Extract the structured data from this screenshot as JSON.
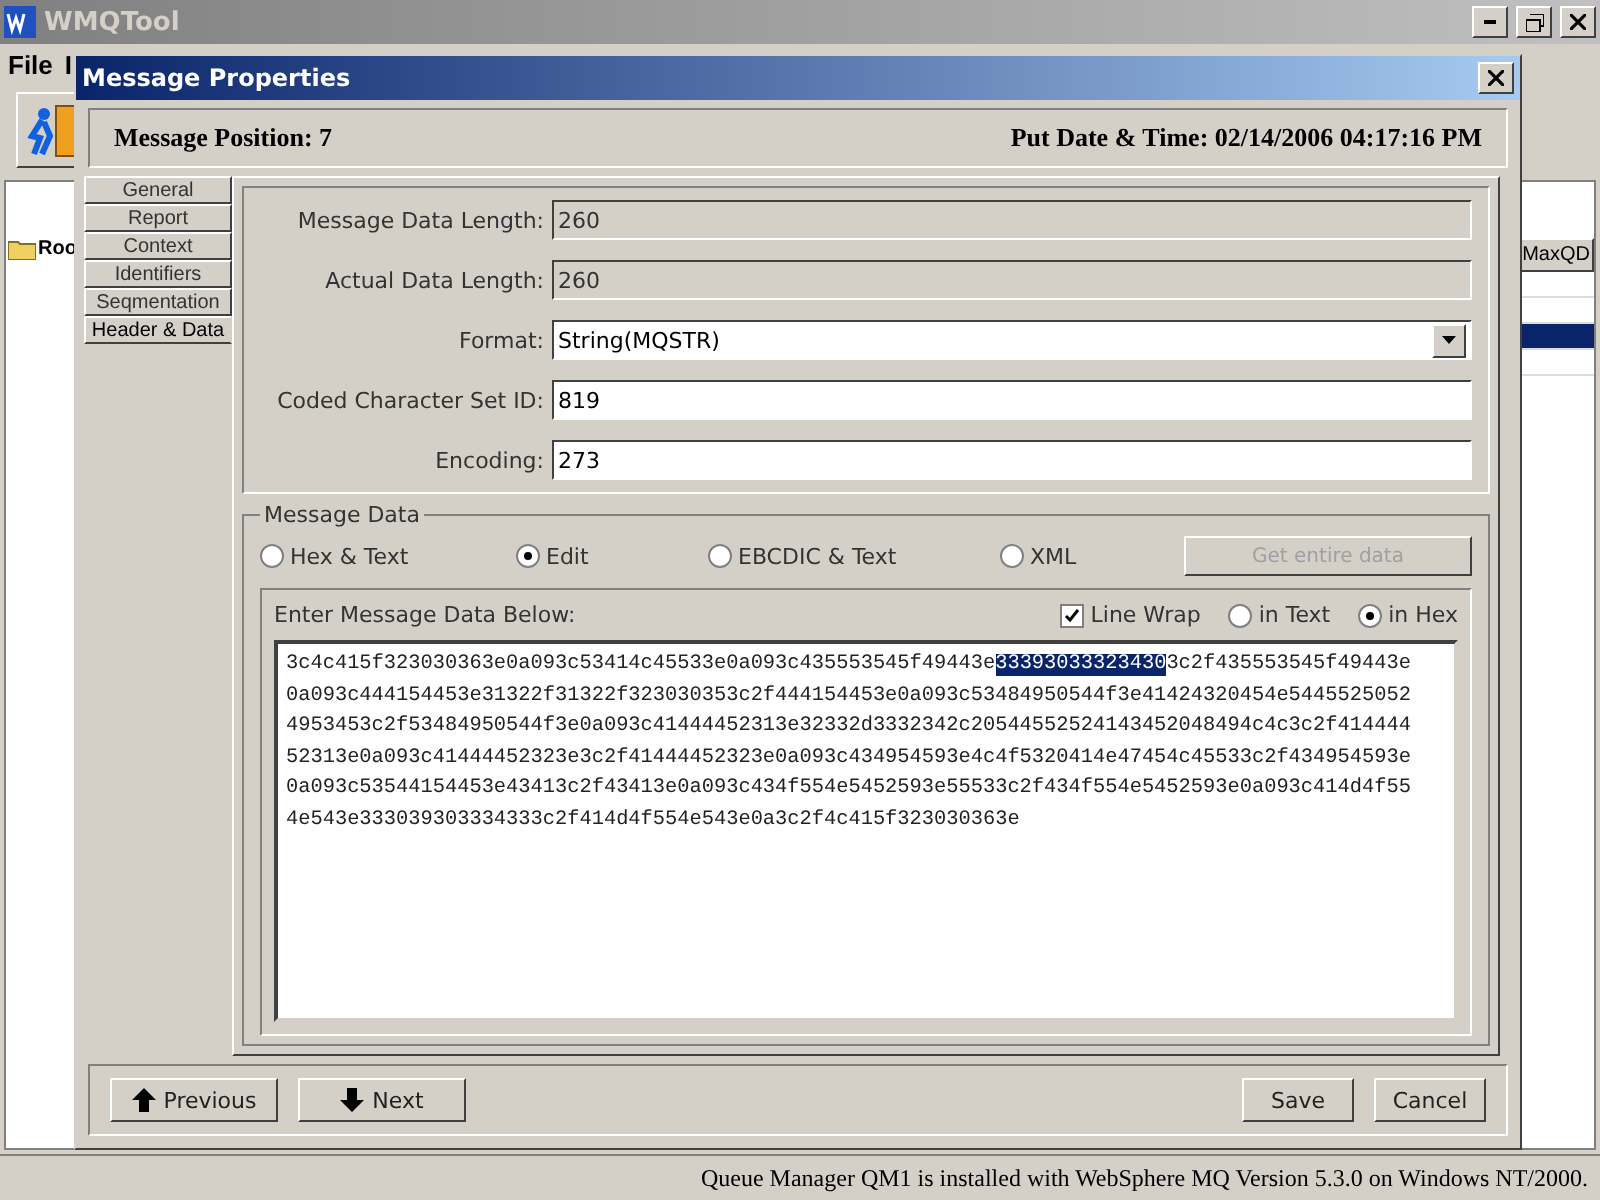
{
  "app": {
    "title": "WMQTool",
    "menu": [
      "File",
      "I"
    ],
    "tree": [
      {
        "label": "Roo"
      }
    ],
    "table": {
      "columns": [
        "MaxQD"
      ],
      "rows": [
        {
          "selected": false
        },
        {
          "selected": false
        },
        {
          "selected": true
        },
        {
          "selected": false
        }
      ]
    },
    "status_bar": "Queue Manager QM1 is installed with WebSphere MQ Version 5.3.0 on Windows NT/2000."
  },
  "dialog": {
    "title": "Message Properties",
    "position": "Message Position: 7",
    "put_date": "Put Date & Time: 02/14/2006 04:17:16 PM",
    "tabs": [
      {
        "label": "General",
        "selected": false
      },
      {
        "label": "Report",
        "selected": false
      },
      {
        "label": "Context",
        "selected": false
      },
      {
        "label": "Identifiers",
        "selected": false
      },
      {
        "label": "Seqmentation",
        "selected": false
      },
      {
        "label": "Header & Data",
        "selected": true
      }
    ],
    "fields": [
      {
        "label": "Message Data Length:",
        "value": "260",
        "kind": "readonly"
      },
      {
        "label": "Actual Data Length:",
        "value": "260",
        "kind": "readonly"
      },
      {
        "label": "Format:",
        "value": "String(MQSTR)",
        "kind": "select"
      },
      {
        "label": "Coded Character Set ID:",
        "value": "819",
        "kind": "text"
      },
      {
        "label": "Encoding:",
        "value": "273",
        "kind": "text"
      }
    ],
    "message_data": {
      "title": "Message Data",
      "modes": [
        {
          "label": "Hex & Text",
          "selected": false
        },
        {
          "label": "Edit",
          "selected": true
        },
        {
          "label": "EBCDIC & Text",
          "selected": false
        },
        {
          "label": "XML",
          "selected": false
        }
      ],
      "get_button": {
        "label": "Get entire data",
        "disabled": true
      },
      "prompt": "Enter Message Data Below:",
      "line_wrap": {
        "label": "Line Wrap",
        "checked": true
      },
      "views": [
        {
          "label": "in Text",
          "selected": false
        },
        {
          "label": "in Hex",
          "selected": true
        }
      ],
      "lines": [
        {
          "segments": [
            {
              "text": "3c4c415f323030363e0a093c53414c45533e0a093c435553545f49443e",
              "selected": false
            },
            {
              "text": "33393033323430",
              "selected": true
            },
            {
              "text": "3c2f435553545f49443e",
              "selected": false
            }
          ]
        },
        {
          "segments": [
            {
              "text": "0a093c444154453e31322f31322f323030353c2f444154453e0a093c53484950544f3e41424320454e5445525052",
              "selected": false
            }
          ]
        },
        {
          "segments": [
            {
              "text": "4953453c2f53484950544f3e0a093c41444452313e32332d3332342c20544552524143452048494c4c3c2f414444",
              "selected": false
            }
          ]
        },
        {
          "segments": [
            {
              "text": "52313e0a093c41444452323e3c2f41444452323e0a093c434954593e4c4f5320414e47454c45533c2f434954593e",
              "selected": false
            }
          ]
        },
        {
          "segments": [
            {
              "text": "0a093c53544154453e43413c2f43413e0a093c434f554e5452593e55533c2f434f554e5452593e0a093c414d4f55",
              "selected": false
            }
          ]
        },
        {
          "segments": [
            {
              "text": "4e543e333039303334333c2f414d4f554e543e0a3c2f4c415f323030363e",
              "selected": false
            }
          ]
        }
      ]
    },
    "buttons": [
      {
        "label": "Previous",
        "kind": "up"
      },
      {
        "label": "Next",
        "kind": "down"
      },
      {
        "label": "Save",
        "kind": "plain"
      },
      {
        "label": "Cancel",
        "kind": "plain"
      }
    ]
  }
}
